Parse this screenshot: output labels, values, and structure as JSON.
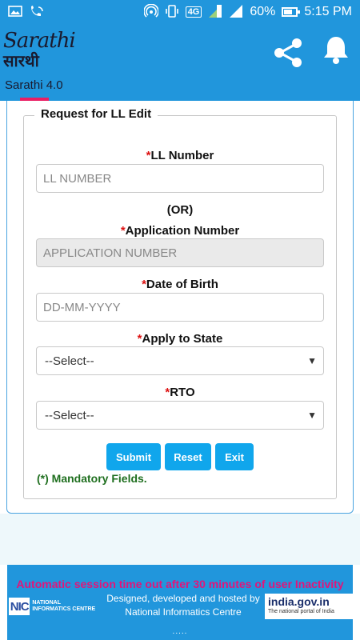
{
  "status_bar": {
    "network": "4G",
    "battery": "60%",
    "time": "5:15 PM"
  },
  "header": {
    "logo_script": "Sarathi",
    "logo_hindi": "सारथी",
    "version": "Sarathi 4.0"
  },
  "form": {
    "legend": "Request for LL Edit",
    "required_mark": "*",
    "ll_number": {
      "label": "LL Number",
      "placeholder": "LL NUMBER"
    },
    "or": "(OR)",
    "application_number": {
      "label": "Application Number",
      "placeholder": "APPLICATION NUMBER"
    },
    "dob": {
      "label": "Date of Birth",
      "placeholder": "DD-MM-YYYY"
    },
    "state": {
      "label": "Apply to State",
      "value": "--Select--"
    },
    "rto": {
      "label": "RTO",
      "value": "--Select--"
    },
    "buttons": {
      "submit": "Submit",
      "reset": "Reset",
      "exit": "Exit"
    },
    "mandatory_note": "(*) Mandatory Fields."
  },
  "footer": {
    "session_notice": "Automatic session time out after 30 minutes of user Inactivity",
    "nic_mark": "NIC",
    "nic_name": "NATIONAL INFORMATICS CENTRE",
    "designed_line1": "Designed, developed and hosted by",
    "designed_line2": "National Informatics Centre",
    "india_portal": "india.gov.in",
    "india_portal_sub": "The national portal of India",
    "dots": "....."
  },
  "colors": {
    "primary": "#2196dc",
    "button": "#10a6ec",
    "accent": "#e91e63",
    "required": "#dd1111",
    "mandatory_text": "#1f6f1f"
  }
}
